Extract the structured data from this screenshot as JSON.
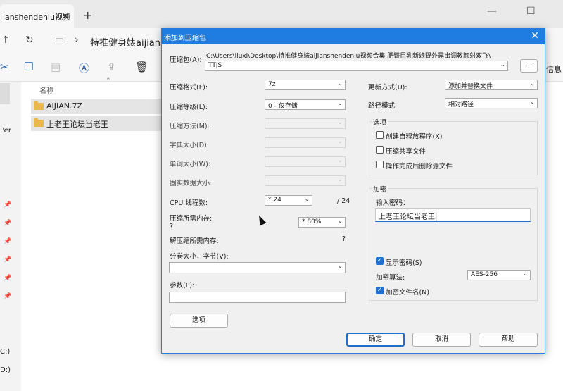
{
  "explorer": {
    "tab_title": "ianshendeniu视频",
    "tab_close": "✕",
    "new_tab": "+",
    "window_buttons": [
      "—",
      "☐",
      "✕"
    ],
    "breadcrumb_arrow": "›",
    "address_text": "特推健身婊aijianshe",
    "toolbar_label": "信息",
    "column_name": "名称",
    "left_text_per": "Per",
    "left_drive_c": "C:)",
    "left_drive_d": "D:)",
    "files": [
      {
        "name": "AIJIAN.7Z"
      },
      {
        "name": "上老王论坛当老王"
      }
    ]
  },
  "dialog": {
    "title": "添加到压缩包",
    "close": "✕",
    "archive_label": "压缩包(A):",
    "archive_path": "C:\\Users\\liuxi\\Desktop\\特推健身婊aijianshendeniu视频合集 肥臀巨乳新娘野外露出调教颜射双飞\\",
    "archive_name": "TTJS",
    "browse_label": "...",
    "format_label": "压缩格式(F):",
    "format_value": "7z",
    "level_label": "压缩等级(L):",
    "level_value": "0 - 仅存储",
    "method_label": "压缩方法(M):",
    "dict_label": "字典大小(D):",
    "word_label": "单词大小(W):",
    "solid_label": "固实数据大小:",
    "cpu_label": "CPU 线程数:",
    "cpu_value": "* 24",
    "cpu_total": "/ 24",
    "mem_label": "压缩所需内存:",
    "mem_q": "?",
    "mem_value": "* 80%",
    "decomp_label": "解压缩所需内存:",
    "decomp_q": "?",
    "volume_label": "分卷大小，字节(V):",
    "params_label": "参数(P):",
    "options_button": "选项",
    "update_label": "更新方式(U):",
    "update_value": "添加并替换文件",
    "path_label": "路径模式",
    "path_value": "相对路径",
    "options_group": "选项",
    "opt_sfx": "创建自释放程序(X)",
    "opt_shared": "压缩共享文件",
    "opt_delete": "操作完成后删除源文件",
    "encrypt_group": "加密",
    "password_label": "输入密码：",
    "password_value": "上老王论坛当老王|",
    "show_password": "显示密码(S)",
    "enc_method_label": "加密算法:",
    "enc_method_value": "AES-256",
    "encrypt_names": "加密文件名(N)",
    "ok": "确定",
    "cancel": "取消",
    "help": "帮助"
  },
  "colors": {
    "accent": "#1f7de2",
    "folder": "#e8b84a"
  },
  "icons": [
    "arrow-up-icon",
    "refresh-icon",
    "monitor-icon",
    "cut-icon",
    "copy-icon",
    "paste-icon",
    "rename-icon",
    "share-icon",
    "delete-icon",
    "pin-icon",
    "folder-icon",
    "mouse-cursor-icon"
  ]
}
